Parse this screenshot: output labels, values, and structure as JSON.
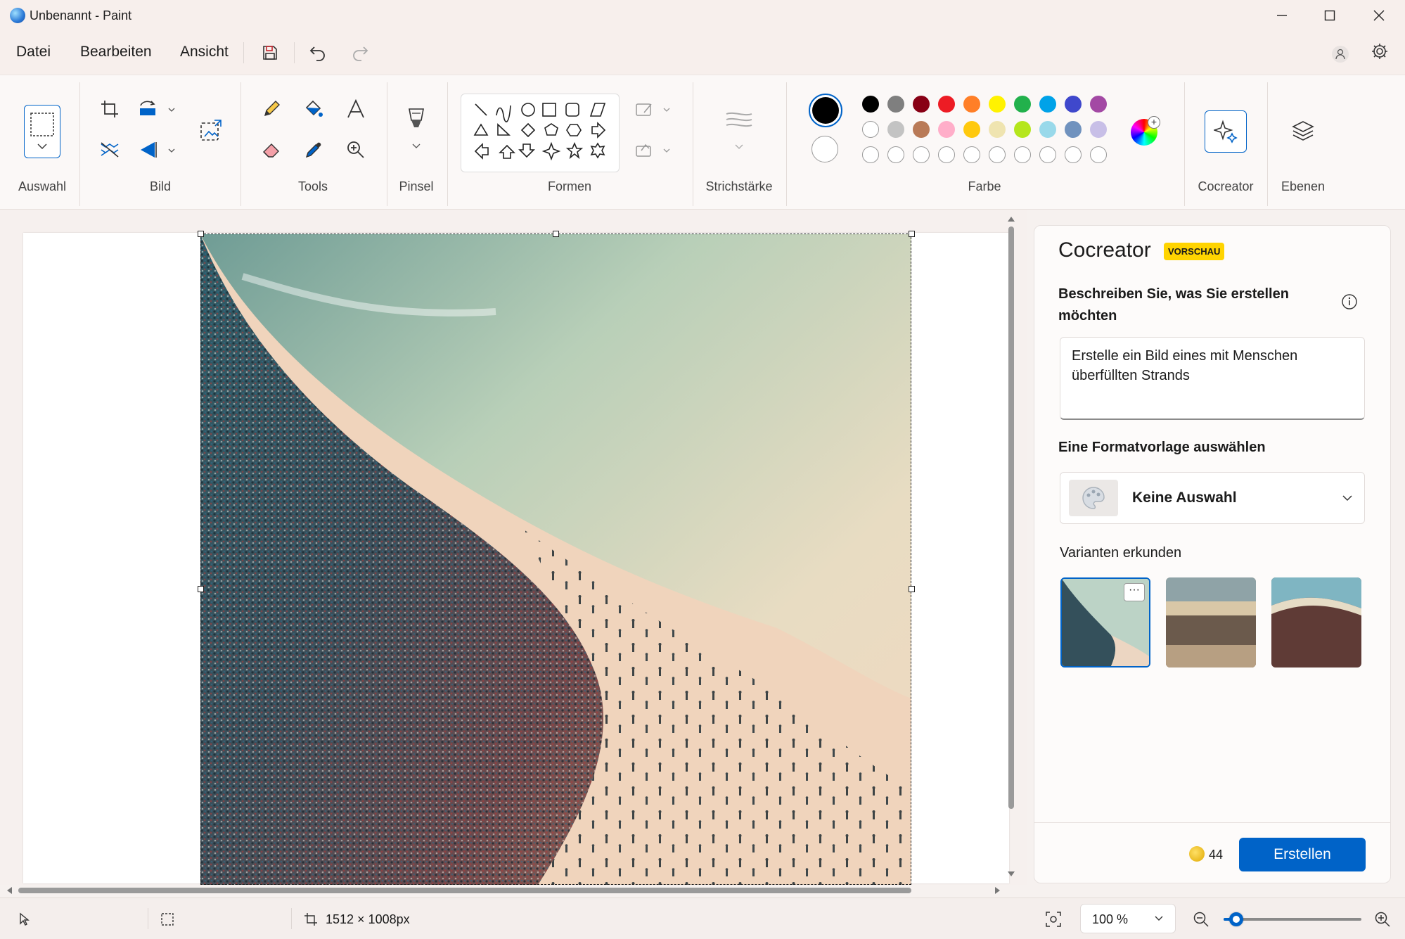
{
  "window": {
    "title": "Unbenannt - Paint"
  },
  "menu": {
    "file": "Datei",
    "edit": "Bearbeiten",
    "view": "Ansicht"
  },
  "ribbon": {
    "selection": "Auswahl",
    "image": "Bild",
    "tools": "Tools",
    "brushes": "Pinsel",
    "shapes": "Formen",
    "stroke": "Strichstärke",
    "color": "Farbe",
    "cocreator": "Cocreator",
    "layers": "Ebenen"
  },
  "colors": {
    "primary": "#000000",
    "secondary": "#ffffff",
    "row1": [
      "#000000",
      "#7f7f7f",
      "#880015",
      "#ed1c24",
      "#ff7f27",
      "#fff200",
      "#22b14c",
      "#00a2e8",
      "#3f48cc",
      "#a349a4"
    ],
    "row2": [
      "#ffffff",
      "#c3c3c3",
      "#b97a57",
      "#ffaec9",
      "#ffc90e",
      "#efe4b0",
      "#b5e61d",
      "#99d9ea",
      "#7092be",
      "#c8bfe7"
    ]
  },
  "panel": {
    "title": "Cocreator",
    "badge": "VORSCHAU",
    "describe_label": "Beschreiben Sie, was Sie erstellen möchten",
    "prompt": "Erstelle ein Bild eines mit Menschen überfüllten Strands",
    "style_label": "Eine Formatvorlage auswählen",
    "style_value": "Keine Auswahl",
    "variants_label": "Varianten erkunden",
    "credits": "44",
    "create_button": "Erstellen"
  },
  "status": {
    "canvas_size": "1512 × 1008px",
    "zoom": "100 %",
    "zoom_fraction": 0.09
  }
}
